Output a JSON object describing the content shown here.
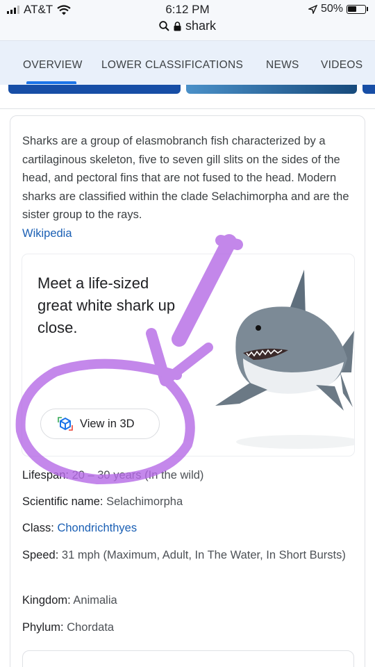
{
  "status_bar": {
    "carrier": "AT&T",
    "time": "6:12 PM",
    "battery": "50%",
    "url": "shark"
  },
  "tabs": [
    {
      "label": "OVERVIEW"
    },
    {
      "label": "LOWER CLASSIFICATIONS"
    },
    {
      "label": "NEWS"
    },
    {
      "label": "VIDEOS"
    }
  ],
  "knowledge_panel": {
    "description": "Sharks are a group of elasmobranch fish characterized by a cartilaginous skeleton, five to seven gill slits on the sides of the head, and pectoral fins that are not fused to the head. Modern sharks are classified within the clade Selachimorpha and are the sister group to the rays.",
    "source": "Wikipedia",
    "promo": {
      "title": "Meet a life-sized great white shark up close.",
      "button": "View in 3D"
    },
    "facts": [
      {
        "label": "Lifespan:",
        "value": "20 – 30 years (In the wild)",
        "link": false
      },
      {
        "label": "Scientific name:",
        "value": "Selachimorpha",
        "link": false
      },
      {
        "label": "Class:",
        "value": "Chondrichthyes",
        "link": true
      },
      {
        "label": "Speed:",
        "value": "31 mph (Maximum, Adult, In The Water, In Short Bursts)",
        "link": false
      },
      {
        "label": "Kingdom:",
        "value": "Animalia",
        "link": false
      },
      {
        "label": "Phylum:",
        "value": "Chordata",
        "link": false
      }
    ]
  },
  "colors": {
    "accent": "#1a73e8",
    "link": "#1a5fb4",
    "annotation": "#b56ae6"
  },
  "icons": [
    "signal-icon",
    "wifi-icon",
    "location-arrow-icon",
    "battery-icon",
    "search-icon",
    "lock-icon",
    "cube-3d-icon"
  ]
}
